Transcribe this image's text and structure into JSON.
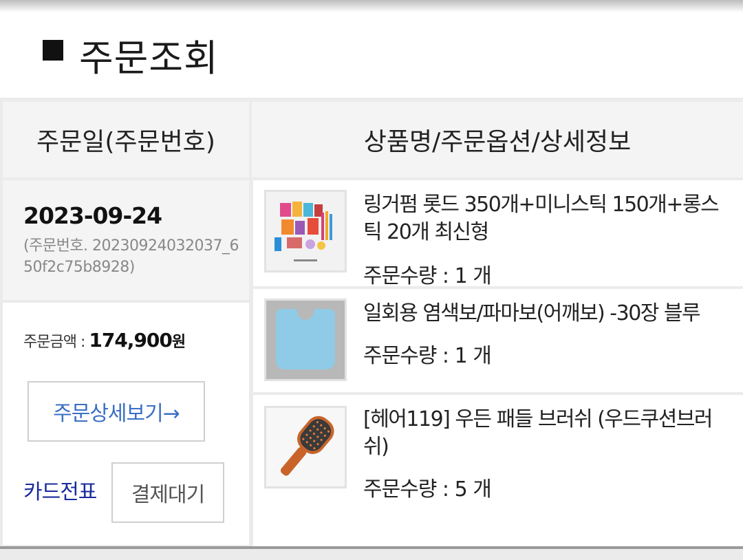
{
  "header": {
    "title": "주문조회"
  },
  "table": {
    "col_date": "주문일(주문번호)",
    "col_product": "상품명/주문옵션/상세정보"
  },
  "order": {
    "date": "2023-09-24",
    "order_no": "(주문번호. 20230924032037_650f2c75b8928)",
    "amount_label": "주문금액 : ",
    "amount_value": "174,900",
    "amount_unit": "원",
    "detail_button": "주문상세보기→",
    "card_link": "카드전표",
    "status_button": "결제대기"
  },
  "items": [
    {
      "name": "링거펌 롯드 350개+미니스틱 150개+롱스틱 20개 최신형",
      "qty": "주문수량 : 1 개",
      "thumb_icon": "perm-rod-set-image"
    },
    {
      "name": "일회용 염색보/파마보(어깨보) -30장 블루",
      "qty": "주문수량 : 1 개",
      "thumb_icon": "cape-image"
    },
    {
      "name": "[헤어119] 우든 패들 브러쉬 (우드쿠션브러쉬)",
      "qty": "주문수량 : 5 개",
      "thumb_icon": "paddle-brush-image"
    }
  ]
}
